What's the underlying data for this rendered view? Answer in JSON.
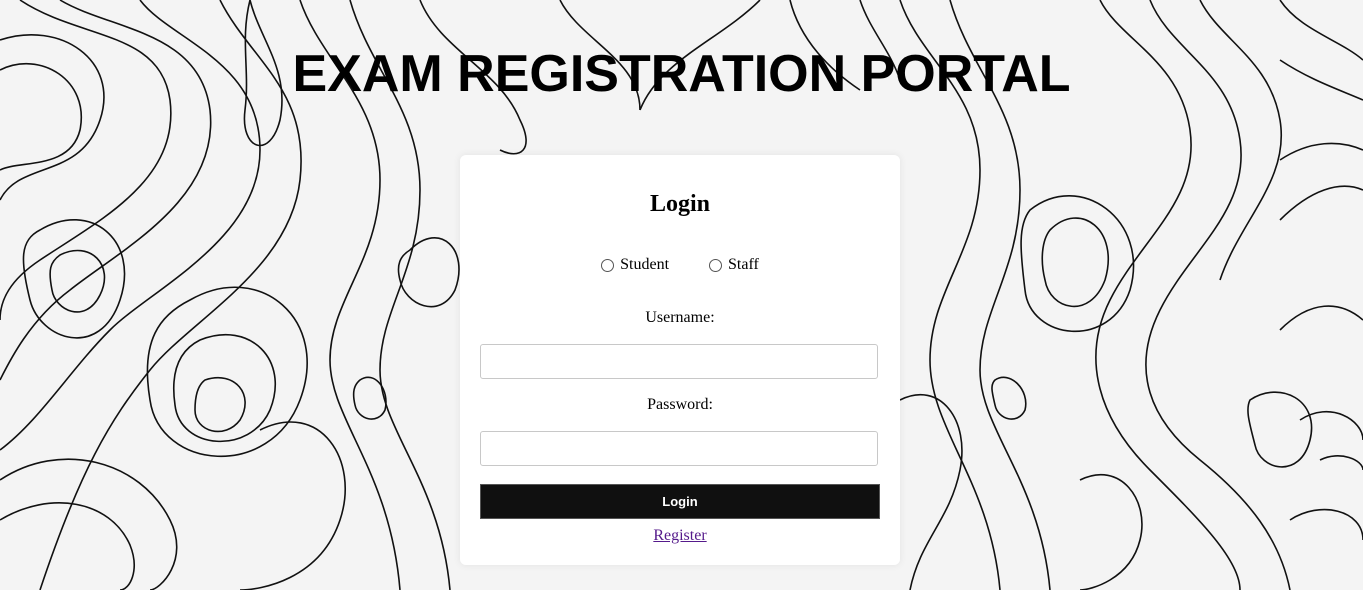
{
  "page": {
    "title": "EXAM REGISTRATION PORTAL"
  },
  "login": {
    "heading": "Login",
    "roles": [
      {
        "label": "Student",
        "selected": false
      },
      {
        "label": "Staff",
        "selected": false
      }
    ],
    "username_label": "Username:",
    "username_value": "",
    "password_label": "Password:",
    "password_value": "",
    "login_button": "Login",
    "register_link": "Register"
  },
  "colors": {
    "background": "#f4f4f4",
    "button": "#101010",
    "link_visited": "#551a8b"
  }
}
